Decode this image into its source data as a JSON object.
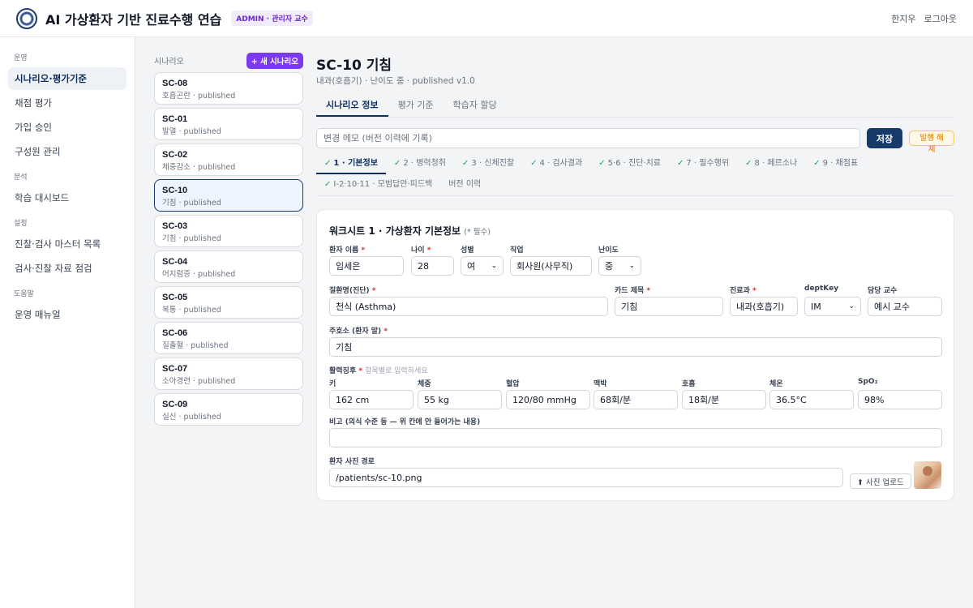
{
  "header": {
    "app_title": "AI 가상환자 기반 진료수행 연습",
    "badge": "ADMIN · 관리자 교수",
    "user_name": "한지우",
    "logout": "로그아웃"
  },
  "sidebar": {
    "sections": [
      {
        "title": "운영",
        "items": [
          "시나리오·평가기준",
          "채점 평가",
          "가입 승인",
          "구성원 관리"
        ]
      },
      {
        "title": "분석",
        "items": [
          "학습 대시보드"
        ]
      },
      {
        "title": "설정",
        "items": [
          "진찰·검사 마스터 목록",
          "검사·진찰 자료 점검"
        ]
      },
      {
        "title": "도움말",
        "items": [
          "운영 매뉴얼"
        ]
      }
    ]
  },
  "scenario_list": {
    "title": "시나리오",
    "new_button": "+ 새 시나리오",
    "items": [
      {
        "code": "SC-08",
        "sub": "호흡곤란 · published"
      },
      {
        "code": "SC-01",
        "sub": "발열 · published"
      },
      {
        "code": "SC-02",
        "sub": "체중감소 · published"
      },
      {
        "code": "SC-10",
        "sub": "기침 · published"
      },
      {
        "code": "SC-03",
        "sub": "기침 · published"
      },
      {
        "code": "SC-04",
        "sub": "어지럼증 · published"
      },
      {
        "code": "SC-05",
        "sub": "복통 · published"
      },
      {
        "code": "SC-06",
        "sub": "질출혈 · published"
      },
      {
        "code": "SC-07",
        "sub": "소아경련 · published"
      },
      {
        "code": "SC-09",
        "sub": "실신 · published"
      }
    ]
  },
  "main": {
    "title": "SC-10 기침",
    "subtitle": "내과(호흡기) · 난이도 중 · published v1.0",
    "tabs": [
      "시나리오 정보",
      "평가 기준",
      "학습자 할당"
    ],
    "memo_placeholder": "변경 메모 (버전 이력에 기록)",
    "save": "저장",
    "unpublish": "발행 해제",
    "ws_tabs": [
      {
        "label": "1 · 기본정보",
        "done": true
      },
      {
        "label": "2 · 병력청취",
        "done": true
      },
      {
        "label": "3 · 신체진찰",
        "done": true
      },
      {
        "label": "4 · 검사결과",
        "done": true
      },
      {
        "label": "5·6 · 진단·치료",
        "done": true
      },
      {
        "label": "7 · 필수행위",
        "done": true
      },
      {
        "label": "8 · 페르소나",
        "done": true
      },
      {
        "label": "9 · 채점표",
        "done": true
      },
      {
        "label": "I-2·10·11 · 모범답안·피드백",
        "done": true
      },
      {
        "label": "버전 이력",
        "done": false
      }
    ]
  },
  "form": {
    "title": "워크시트 1 · 가상환자 기본정보",
    "required_note": "(* 필수)",
    "patient_name": {
      "label": "환자 이름",
      "value": "임세은"
    },
    "age": {
      "label": "나이",
      "value": "28"
    },
    "sex": {
      "label": "성별",
      "value": "여"
    },
    "job": {
      "label": "직업",
      "value": "회사원(사무직)"
    },
    "difficulty": {
      "label": "난이도",
      "value": "중"
    },
    "diagnosis": {
      "label": "질환명(진단)",
      "value": "천식 (Asthma)"
    },
    "card_title": {
      "label": "카드 제목",
      "value": "기침"
    },
    "department": {
      "label": "진료과",
      "value": "내과(호흡기)"
    },
    "dept_key": {
      "label": "deptKey",
      "value": "IM"
    },
    "professor": {
      "label": "담당 교수",
      "value": "예시 교수"
    },
    "chief_complaint": {
      "label": "주호소 (환자 말)",
      "value": "기침"
    },
    "vitals_label": "활력징후",
    "vitals_hint": "항목별로 입력하세요",
    "vitals": [
      {
        "label": "키",
        "value": "162 cm"
      },
      {
        "label": "체중",
        "value": "55 kg"
      },
      {
        "label": "혈압",
        "value": "120/80 mmHg"
      },
      {
        "label": "맥박",
        "value": "68회/분"
      },
      {
        "label": "호흡",
        "value": "18회/분"
      },
      {
        "label": "체온",
        "value": "36.5°C"
      },
      {
        "label": "SpO₂",
        "value": "98%"
      }
    ],
    "remarks": {
      "label": "비고 (의식 수준 등 — 위 칸에 안 들어가는 내용)",
      "value": ""
    },
    "photo_path": {
      "label": "환자 사진 경로",
      "value": "/patients/sc-10.png"
    },
    "upload": "⬆ 사진 업로드"
  }
}
